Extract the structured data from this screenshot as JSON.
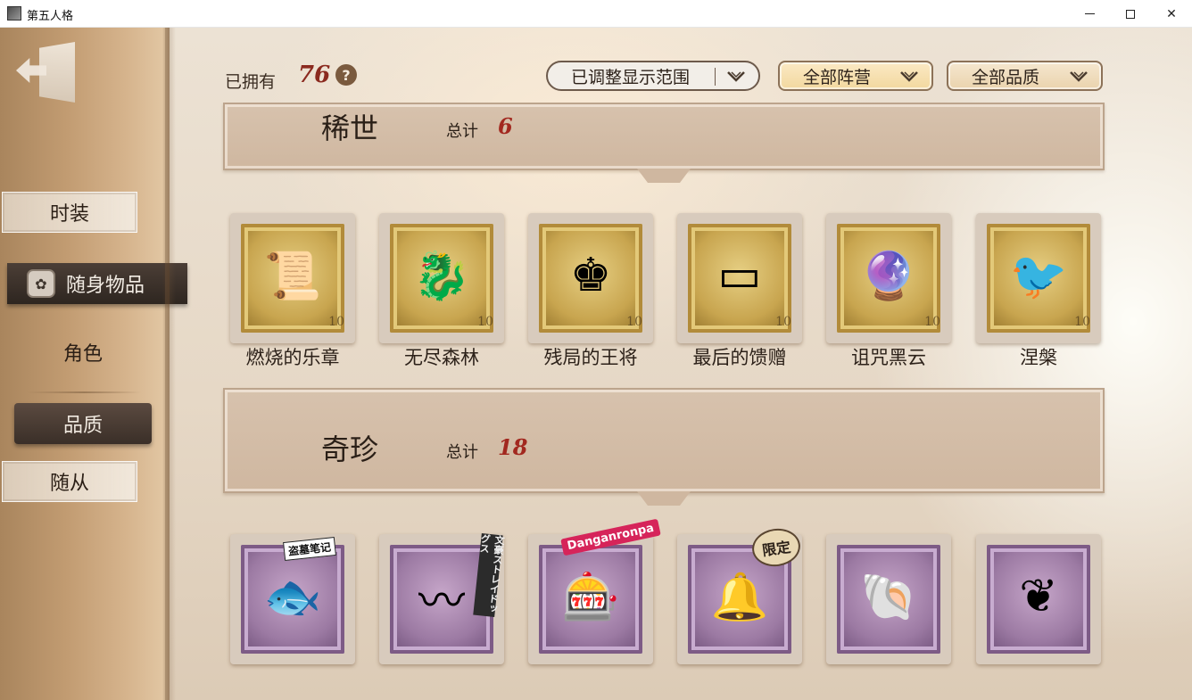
{
  "window": {
    "title": "第五人格"
  },
  "sidebar": {
    "items": [
      {
        "label": "时装"
      },
      {
        "label": "随身物品",
        "icon": "emblem-icon"
      },
      {
        "label": "角色"
      },
      {
        "label": "品质"
      },
      {
        "label": "随从"
      }
    ],
    "selected": "随身物品"
  },
  "header": {
    "owned_label": "已拥有",
    "owned_count": "76",
    "help": "?",
    "filters": {
      "range": "已调整显示范围",
      "camp": "全部阵营",
      "quality": "全部品质"
    }
  },
  "sections": [
    {
      "title": "稀世",
      "total_label": "总计",
      "total": "6",
      "stamp_color": "#c8a54f",
      "items": [
        {
          "label": "燃烧的乐章",
          "icon": "scroll-icon"
        },
        {
          "label": "无尽森林",
          "icon": "dragon-lamp-icon"
        },
        {
          "label": "残局的王将",
          "icon": "chess-king-icon"
        },
        {
          "label": "最后的馈赠",
          "icon": "harmonica-icon"
        },
        {
          "label": "诅咒黑云",
          "icon": "crystal-ball-icon"
        },
        {
          "label": "涅槃",
          "icon": "phoenix-icon"
        }
      ],
      "stamp_value": "10"
    },
    {
      "title": "奇珍",
      "total_label": "总计",
      "total": "18",
      "stamp_color": "#9c7aa3",
      "items": [
        {
          "icon": "fish-icon",
          "tag": "盗墓笔记"
        },
        {
          "icon": "tail-icon",
          "tag": "文豪ストレイドッグス"
        },
        {
          "icon": "slot-machine-icon",
          "tag": "Danganronpa"
        },
        {
          "icon": "bell-icon",
          "tag": "限定"
        },
        {
          "icon": "shell-pearl-icon"
        },
        {
          "icon": "wreath-icon"
        }
      ]
    }
  ]
}
